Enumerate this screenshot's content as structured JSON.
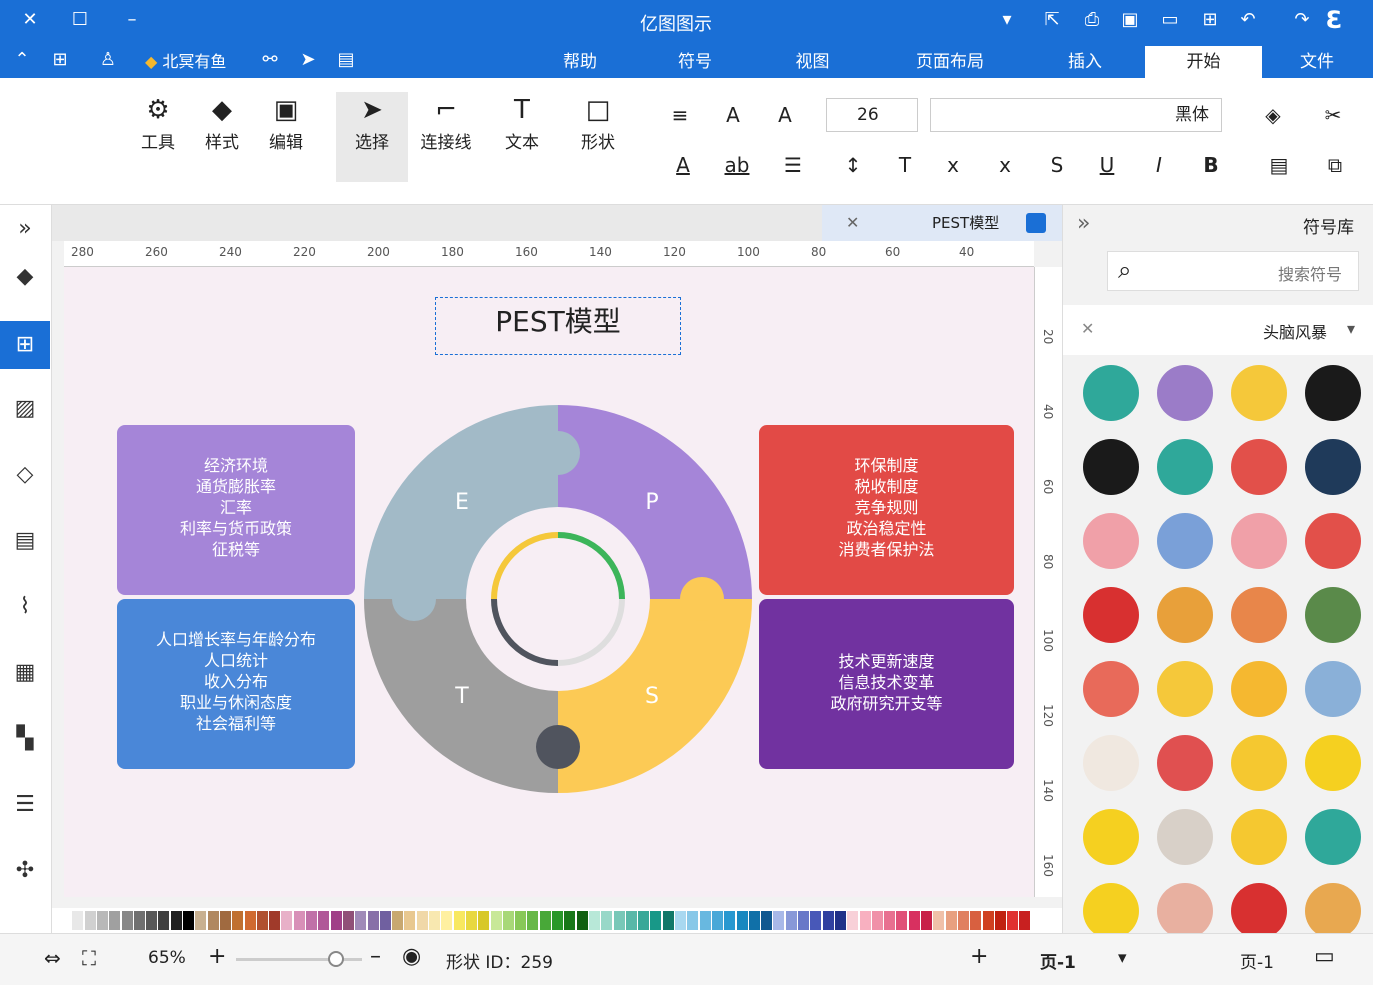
{
  "app": {
    "title": "亿图图示"
  },
  "menus": [
    "文件",
    "开始",
    "插入",
    "页面布局",
    "视图",
    "符号",
    "帮助"
  ],
  "account": {
    "label": "北冥有鱼"
  },
  "ribbon": {
    "font_family": "黑体",
    "font_size": "26",
    "tools": [
      "形状",
      "文本",
      "连接线",
      "选择",
      "编辑",
      "样式",
      "工具"
    ]
  },
  "doc": {
    "tab_title": "PEST模型"
  },
  "ruler": {
    "h_ticks": [
      "40",
      "60",
      "80",
      "100",
      "120",
      "140",
      "160",
      "180",
      "200",
      "220",
      "240",
      "260",
      "280"
    ],
    "v_ticks": [
      "20",
      "40",
      "60",
      "80",
      "100",
      "120",
      "140",
      "160"
    ]
  },
  "diagram": {
    "title": "PEST模型",
    "pieces": {
      "p": "P",
      "e": "E",
      "s": "S",
      "t": "T"
    },
    "card_political": [
      "环保制度",
      "税收制度",
      "竞争规则",
      "政治稳定性",
      "消费者保护法"
    ],
    "card_economic": [
      "经济环境",
      "通货膨胀率",
      "汇率",
      "利率与货币政策",
      "征税等"
    ],
    "card_tech": [
      "技术更新速度",
      "信息技术变革",
      "政府研究开支等"
    ],
    "card_social": [
      "人口增长率与年龄分布",
      "人口统计",
      "收入分布",
      "职业与休闲态度",
      "社会福利等"
    ]
  },
  "panel": {
    "title": "符号库",
    "search_placeholder": "搜索符号",
    "category": "头脑风暴"
  },
  "status": {
    "page_label": "页-1",
    "page_tab": "页-1",
    "add": "+",
    "shape_id": "形状 ID：259",
    "zoom": "65%"
  },
  "colors": {
    "accent": "#1a6fd6",
    "political": "#e24a46",
    "economic": "#a585d8",
    "tech": "#7132a0",
    "social": "#4a87d8"
  }
}
